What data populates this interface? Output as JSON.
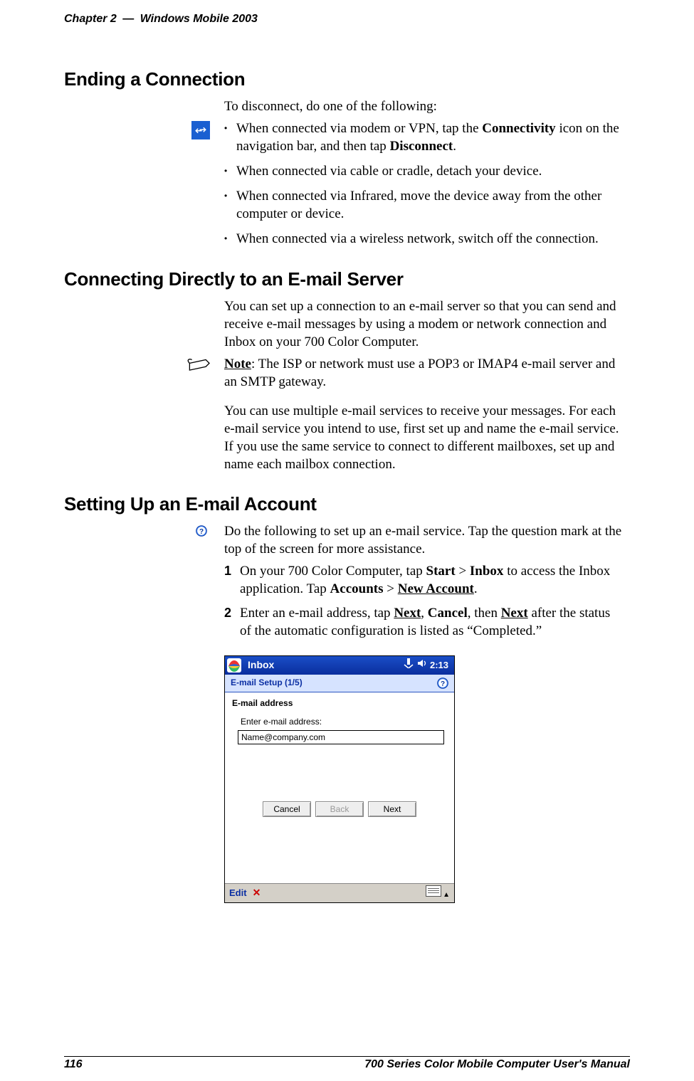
{
  "header": {
    "chapter_label": "Chapter 2",
    "separator": "—",
    "chapter_title": "Windows Mobile 2003"
  },
  "sections": {
    "ending": {
      "heading": "Ending a Connection",
      "intro": "To disconnect, do one of the following:",
      "bullets": {
        "b1_pre": "When connected via modem or VPN, tap the ",
        "b1_bold1": "Connectivity",
        "b1_mid": " icon on the navigation bar, and then tap ",
        "b1_bold2": "Disconnect",
        "b1_end": ".",
        "b2": "When connected via cable or cradle, detach your device.",
        "b3": "When connected via Infrared, move the device away from the other computer or device.",
        "b4": "When connected via a wireless network, switch off the connection."
      }
    },
    "connecting": {
      "heading": "Connecting Directly to an E-mail Server",
      "p1": "You can set up a connection to an e-mail server so that you can send and receive e-mail messages by using a modem or network connection and Inbox on your 700 Color Computer.",
      "note_label": "Note",
      "note_text": ": The ISP or network must use a POP3 or IMAP4 e-mail server and an SMTP gateway.",
      "p2": "You can use multiple e-mail services to receive your messages. For each e-mail service you intend to use, first set up and name the e-mail service. If you use the same service to connect to different mailboxes, set up and name each mailbox connection."
    },
    "setup": {
      "heading": "Setting Up an E-mail Account",
      "intro": "Do the following to set up an e-mail service. Tap the question mark at the top of the screen for more assistance.",
      "step1_pre": "On your 700 Color Computer, tap ",
      "step1_b1": "Start",
      "step1_gt1": " > ",
      "step1_b2": "Inbox",
      "step1_mid": " to access the Inbox application. Tap ",
      "step1_b3": "Accounts",
      "step1_gt2": " > ",
      "step1_b4": "New Account",
      "step1_end": ".",
      "step2_pre": "Enter an e-mail address, tap ",
      "step2_b1": "Next",
      "step2_c1": ", ",
      "step2_b2": "Cancel",
      "step2_c2": ", then ",
      "step2_b3": "Next",
      "step2_end": " after the status of the automatic configuration is listed as “Completed.”"
    }
  },
  "pda": {
    "title": "Inbox",
    "time": "2:13",
    "setup_title": "E-mail Setup (1/5)",
    "legend": "E-mail address",
    "label": "Enter e-mail address:",
    "field_value": "Name@company.com",
    "btn_cancel": "Cancel",
    "btn_back": "Back",
    "btn_next": "Next",
    "edit": "Edit"
  },
  "footer": {
    "page": "116",
    "manual": "700 Series Color Mobile Computer User's Manual"
  }
}
